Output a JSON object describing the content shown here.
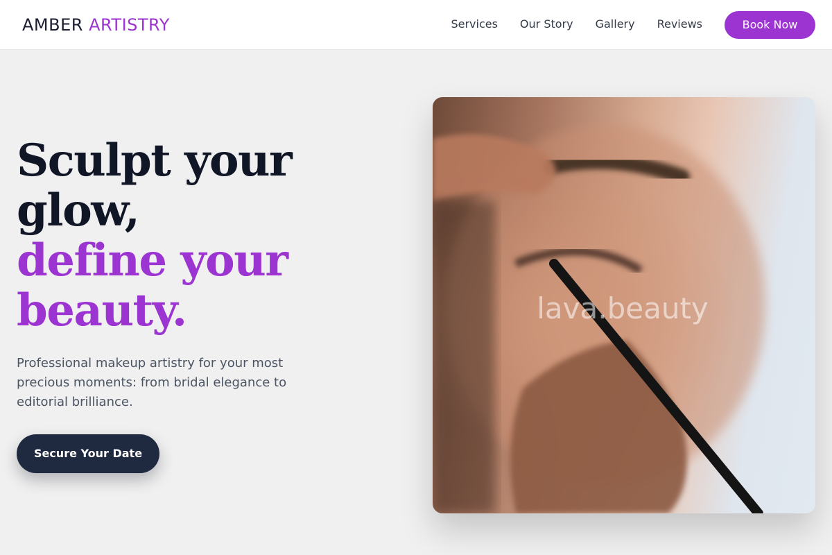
{
  "brand": {
    "name_part1": "AMBER",
    "name_part2": "ARTISTRY"
  },
  "nav": {
    "links": [
      "Services",
      "Our Story",
      "Gallery",
      "Reviews"
    ],
    "cta_label": "Book Now"
  },
  "hero": {
    "title_lines": [
      "Sculpt your",
      "glow,",
      "define your",
      "beauty."
    ],
    "subtitle": "Professional makeup artistry for your most precious moments: from bridal elegance to editorial brilliance.",
    "cta_label": "Secure Your Date",
    "image_watermark": "lava.beauty"
  },
  "colors": {
    "accent": "#9b34d0",
    "dark": "#111626",
    "button_dark": "#1f2a40",
    "background": "#f0f0f0"
  }
}
